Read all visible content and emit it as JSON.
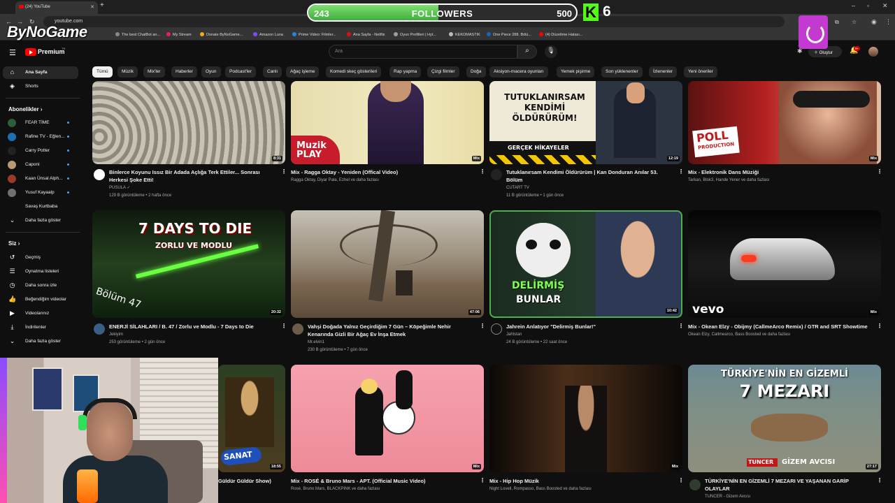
{
  "browser": {
    "tab_title": "(24) YouTube",
    "url": "youtube.com",
    "bookmarks": [
      "The best ChatBot an...",
      "My Stream",
      "Donate ByNoGame...",
      "Amazon Luna",
      "Prime Video: Filmler...",
      "Ana Sayfa - Netflix",
      "Oyun Profilleri | Hyt...",
      "KEKOMASTIK",
      "One Piece 288. Bölü...",
      "(4) Düzeltme Hatası..."
    ]
  },
  "overlay": {
    "brand": "ByNoGame",
    "followers_current": "243",
    "followers_label": "FOLLOWERS",
    "followers_goal": "500",
    "followers_progress": 0.486,
    "kick_letter": "K",
    "kick_count": "6"
  },
  "header": {
    "brand": "Premium",
    "region": "TR",
    "search_placeholder": "Ara",
    "create_label": "Oluştur",
    "notif_count": "9+"
  },
  "chips": [
    "Tümü",
    "Müzik",
    "Mix'ler",
    "Haberler",
    "Oyun",
    "Podcast'ler",
    "Canlı",
    "Ağaç işleme",
    "Komedi skeç gösterileri",
    "Rap yapma",
    "Çizgi filmler",
    "Doğa",
    "Aksiyon-macera oyunları",
    "Yemek pişirme",
    "Son yüklenenler",
    "İzlenenler",
    "Yeni öneriler"
  ],
  "sidebar": {
    "top": [
      {
        "label": "Ana Sayfa",
        "icon": "home-icon"
      },
      {
        "label": "Shorts",
        "icon": "shorts-icon"
      }
    ],
    "subs_header": "Abonelikler",
    "subs": [
      {
        "label": "FEAR TİME",
        "color": "#2e5d3a"
      },
      {
        "label": "Rafine TV - Eğlen...",
        "color": "#1b6fb5"
      },
      {
        "label": "Carry Potter",
        "color": "#222222"
      },
      {
        "label": "Caponi",
        "color": "#b89a73"
      },
      {
        "label": "Kaan Ünsal Alph...",
        "color": "#9c3a2a"
      },
      {
        "label": "Yusuf Kayaalp",
        "color": "#707070"
      },
      {
        "label": "Savaş Kurtbaba",
        "color": "#0f0f0f"
      }
    ],
    "subs_more": "Daha fazla göster",
    "you_header": "Siz",
    "you": [
      {
        "label": "Geçmiş",
        "icon": "history-icon"
      },
      {
        "label": "Oynatma listeleri",
        "icon": "playlist-icon"
      },
      {
        "label": "Daha sonra izle",
        "icon": "watch-later-icon"
      },
      {
        "label": "Beğendiğim videolar",
        "icon": "like-icon"
      },
      {
        "label": "Videolarınız",
        "icon": "your-videos-icon"
      },
      {
        "label": "İndirilenler",
        "icon": "download-icon"
      },
      {
        "label": "Daha fazla göster",
        "icon": "chevron-down-icon"
      }
    ]
  },
  "videos": [
    {
      "title": "Binlerce Koyunu Issız Bir Adada Açlığa Terk Ettiler... Sonrası Herkesi Şoke Etti!",
      "channel": "PUSULA",
      "verified": "✓",
      "meta": "129 B görüntüleme • 2 hafta önce",
      "duration": "8:31"
    },
    {
      "title": "Mix - Ragga Oktay - Yeniden (Offical Video)",
      "channel": "Ragga Oktay, Diyar Pala, Ezhel ve daha fazlası",
      "meta": "",
      "duration": "Mix",
      "thumb_text": [
        "Muzik",
        "PLAY"
      ]
    },
    {
      "title": "Tutuklanırsam Kendimi Öldürürüm | Kan Donduran Anılar 53. Bölüm",
      "channel": "CUTART TV",
      "meta": "11 B görüntüleme • 1 gün önce",
      "duration": "12:19",
      "thumb_text": [
        "TUTUKLANIRSAM",
        "KENDİMİ",
        "ÖLDÜRÜRÜM!",
        "GERÇEK HİKAYELER"
      ]
    },
    {
      "title": "Mix - Elektronik Dans Müziği",
      "channel": "Tarkan, Blok3, Hande Yener ve daha fazlası",
      "meta": "",
      "duration": "Mix",
      "thumb_text": [
        "POLL",
        "PRODUCTION"
      ]
    },
    {
      "title": "ENERJİ SİLAHLARI / B. 47 / Zorlu ve Modlu - 7 Days to Die",
      "channel": "Jekiyim",
      "meta": "253 görüntüleme • 2 gün önce",
      "duration": "20:32",
      "thumb_text": [
        "7 DAYS TO DIE",
        "ZORLU VE MODLU",
        "Bölüm 47"
      ]
    },
    {
      "title": "Vahşi Doğada Yalnız Geçirdiğim 7 Gün – Köpeğimle Nehir Kenarında Gizli Bir Ağaç Ev İnşa Etmek",
      "channel": "Mr.elvin1",
      "meta": "230 B görüntüleme • 7 gün önce",
      "duration": "47:06"
    },
    {
      "title": "Jahrein Anlatıyor \"Delirmiş Bunlar!\"",
      "channel": "Jahlstan",
      "meta": "24 B görüntüleme • 22 saat önce",
      "duration": "10:42",
      "thumb_text": [
        "DELİRMİŞ",
        "BUNLAR"
      ]
    },
    {
      "title": "Mix - Okean Elzy - Obijmy (CallmeArco Remix) / GTR and SRT Showtime",
      "channel": "Okean Elzy, Callmearco, Bass Boosted ve daha fazlası",
      "meta": "",
      "duration": "Mix",
      "thumb_text": [
        "vevo"
      ]
    },
    {
      "title": "Güldür Güldür Show)",
      "channel": "",
      "meta": "",
      "duration": "18:55",
      "thumb_text": [
        "SANAT"
      ]
    },
    {
      "title": "Mix - ROSÉ & Bruno Mars - APT. (Official Music Video)",
      "channel": "Rosé, Bruno Mars, BLACKPINK ve daha fazlası",
      "meta": "",
      "duration": "Mix"
    },
    {
      "title": "Mix - Hip Hop Müzik",
      "channel": "Night Lovell, Rompasso, Bass Boosted ve daha fazlası",
      "meta": "",
      "duration": "Mix"
    },
    {
      "title": "TÜRKİYE'NİN EN GİZEMLİ 7 MEZARI VE YAŞANAN GARİP OLAYLAR",
      "channel": "TUNCER - Gizem Avcısı",
      "meta": "",
      "duration": "27:17",
      "thumb_text": [
        "TÜRKİYE'NİN EN GİZEMLİ",
        "7 MEZARI",
        "TUNCER",
        "GİZEM AVCISI"
      ]
    }
  ]
}
